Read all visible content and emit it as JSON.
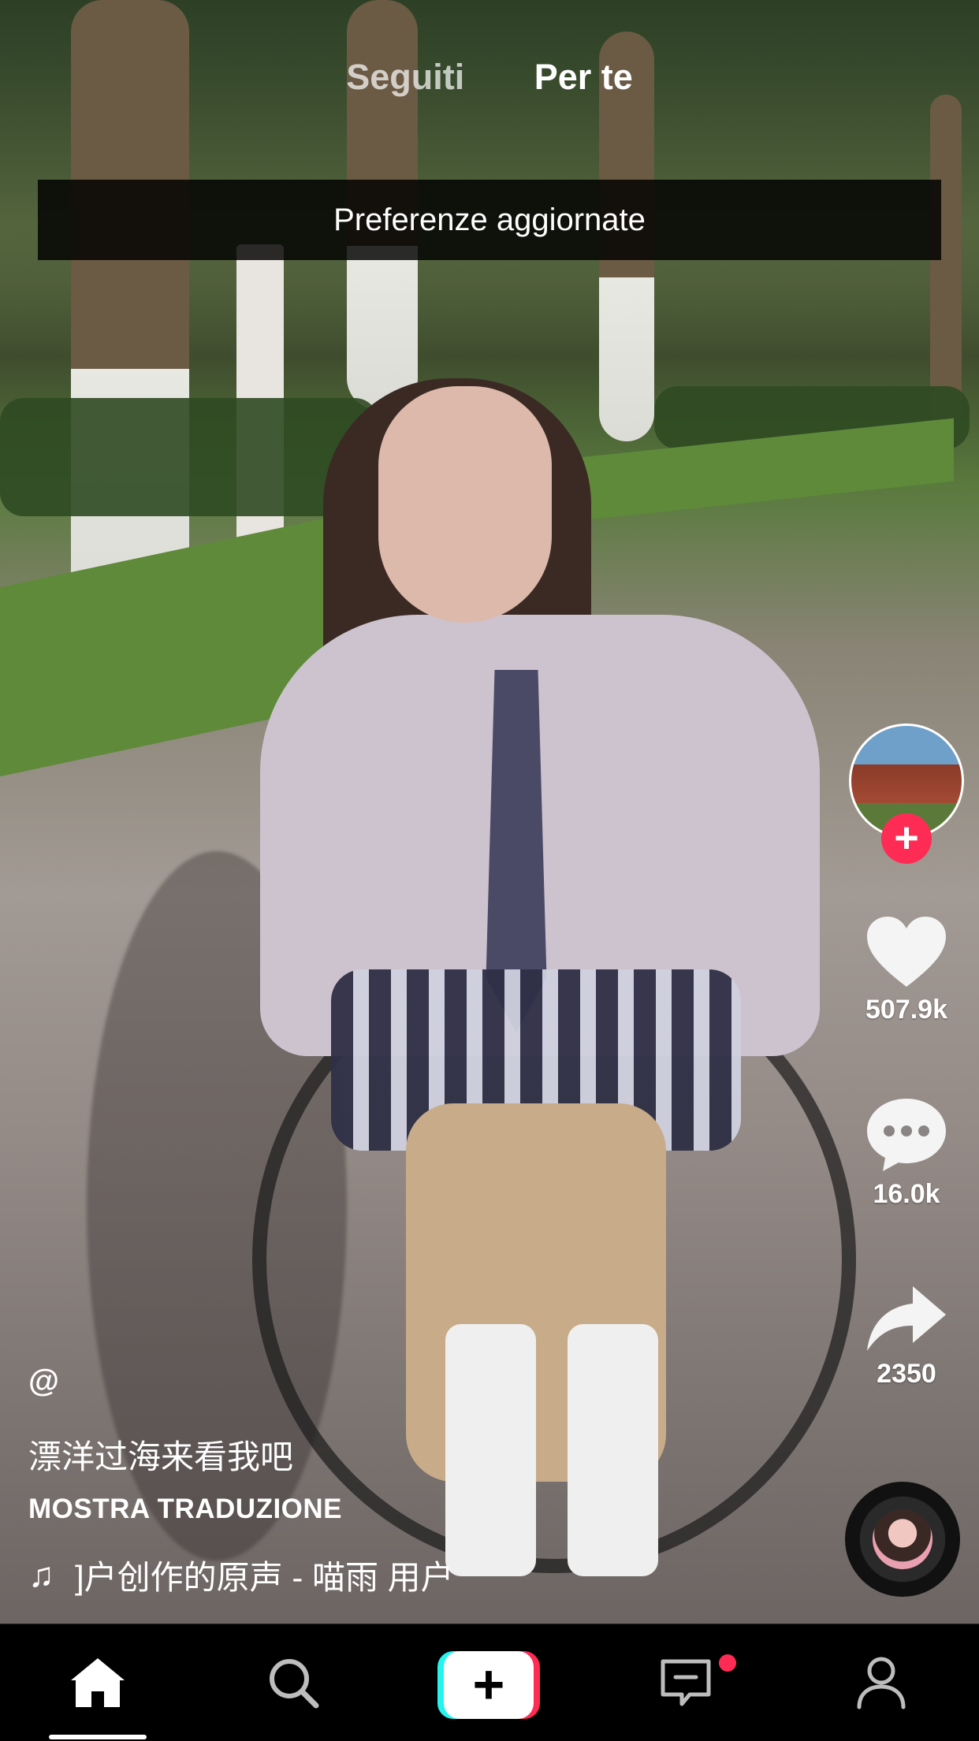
{
  "top_tabs": {
    "following": "Seguiti",
    "for_you": "Per te"
  },
  "toast": "Preferenze aggiornate",
  "actions": {
    "likes": "507.9k",
    "comments": "16.0k",
    "shares": "2350"
  },
  "post": {
    "handle": "@",
    "caption": "漂洋过海来看我吧",
    "translate_label": "MOSTRA TRADUZIONE",
    "music": "]户创作的原声 - 喵雨    用户"
  },
  "colors": {
    "accent": "#fe2c55",
    "cyan": "#25f4ee"
  },
  "icons": {
    "nav": [
      "home-icon",
      "search-icon",
      "create-icon",
      "inbox-icon",
      "profile-icon"
    ],
    "rail": [
      "heart-icon",
      "comment-icon",
      "share-icon"
    ]
  }
}
